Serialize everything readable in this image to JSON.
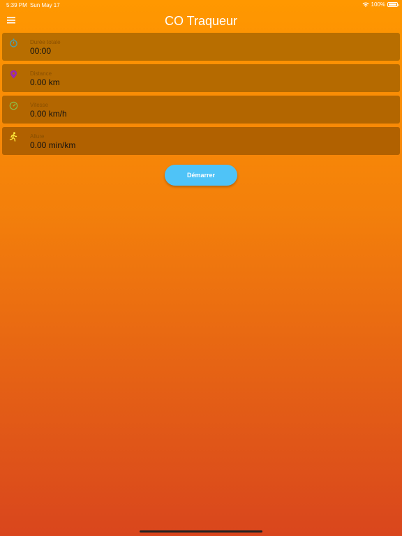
{
  "status_bar": {
    "time": "5:39 PM",
    "date": "Sun May 17",
    "battery": "100%",
    "icons": [
      "wifi-icon",
      "battery-icon"
    ]
  },
  "app_bar": {
    "title": "CO Traqueur",
    "menu_icon": "hamburger-menu-icon"
  },
  "cards": [
    {
      "label": "Durée totale",
      "value": "00:00",
      "icon": "stopwatch-icon",
      "icon_color": "#43a5b8",
      "bg": "#b86e00"
    },
    {
      "label": "Distance",
      "value": "0.00 km",
      "icon": "map-pin-icon",
      "icon_color": "#9c27b0",
      "bg": "#b56a00"
    },
    {
      "label": "Vitesse",
      "value": "0.00 km/h",
      "icon": "speedometer-icon",
      "icon_color": "#8bc34a",
      "bg": "#b36600"
    },
    {
      "label": "Allure",
      "value": "0.00 min/km",
      "icon": "running-person-icon",
      "icon_color": "#ffeb3b",
      "bg": "#b16100"
    }
  ],
  "start_button": {
    "label": "Démarrer",
    "color": "#4fc3f7"
  },
  "theme": {
    "gradient_top": "#ff9800",
    "gradient_bottom": "#d9461d"
  }
}
